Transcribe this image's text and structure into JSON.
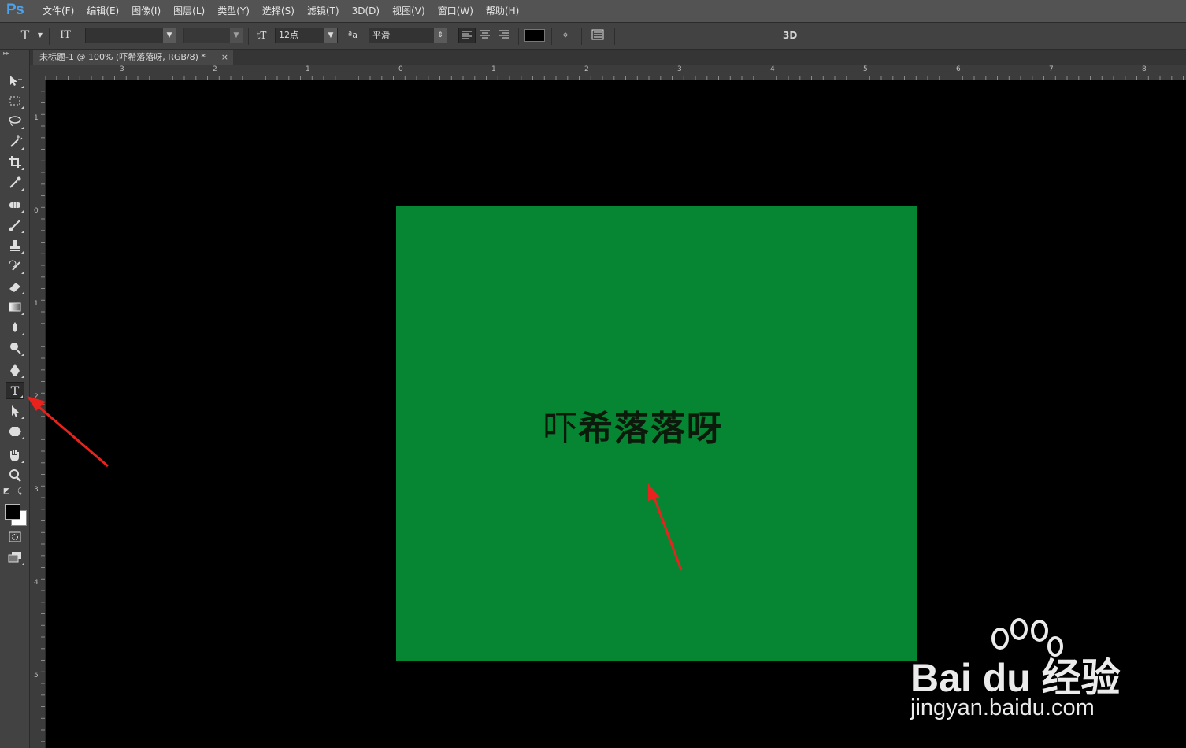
{
  "app": {
    "logo": "Ps"
  },
  "menu": [
    "文件(F)",
    "编辑(E)",
    "图像(I)",
    "图层(L)",
    "类型(Y)",
    "选择(S)",
    "滤镜(T)",
    "3D(D)",
    "视图(V)",
    "窗口(W)",
    "帮助(H)"
  ],
  "options": {
    "tool_icon": "T",
    "orient_icon": "IT",
    "font_family": "",
    "font_style": "",
    "size_icon": "tT",
    "font_size": "12点",
    "aa_icon": "ªa",
    "anti_alias": "平滑",
    "text_color": "#000000",
    "label_3d": "3D"
  },
  "document": {
    "tab_title": "未标题-1 @ 100% (吓希落落呀, RGB/8) *",
    "close": "×",
    "background_color": "#068533",
    "text_regular": "吓",
    "text_bold": "希落落呀"
  },
  "rulers": {
    "h_labels": [
      "3",
      "2",
      "1",
      "0",
      "1",
      "2",
      "3",
      "4",
      "5",
      "6",
      "7",
      "8"
    ],
    "v_labels": [
      "1",
      "0",
      "1",
      "2",
      "3",
      "4",
      "5"
    ]
  },
  "watermark": {
    "brand": "Bai du 经验",
    "url": "jingyan.baidu.com"
  }
}
